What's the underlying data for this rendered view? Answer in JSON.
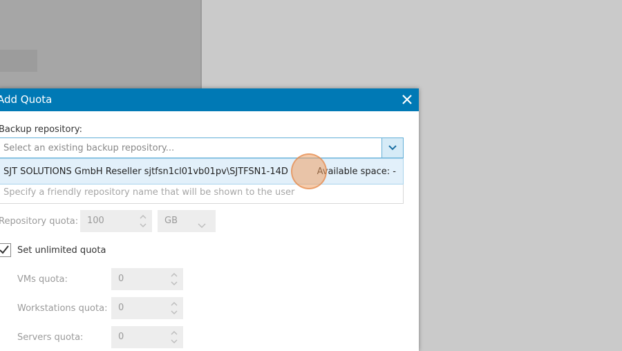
{
  "dialog": {
    "title": "Add Quota",
    "backup_repository_label": "Backup repository:",
    "repository_select": {
      "placeholder": "Select an existing backup repository...",
      "option": {
        "name": "SJT SOLUTIONS GmbH Reseller sjtfsn1cl01vb01pv\\SJTFSN1-14D",
        "available_space": "Available space: -"
      }
    },
    "friendly_name_placeholder": "Specify a friendly repository name that will be shown to the user",
    "repository_quota": {
      "label": "Repository quota:",
      "value": "100",
      "unit": "GB"
    },
    "unlimited_quota": {
      "label": "Set unlimited quota",
      "checked": true
    },
    "vms_quota": {
      "label": "VMs quota:",
      "value": "0"
    },
    "workstations_quota": {
      "label": "Workstations quota:",
      "value": "0"
    },
    "servers_quota": {
      "label": "Servers quota:",
      "value": "0"
    }
  },
  "colors": {
    "titlebar": "#0079b5",
    "selection": "#e2f0fa",
    "cursor_highlight": "#eea064"
  }
}
